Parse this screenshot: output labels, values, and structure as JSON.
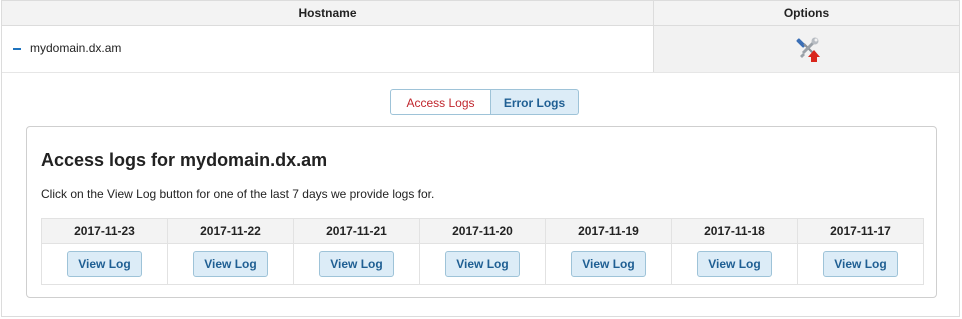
{
  "table": {
    "header_hostname": "Hostname",
    "header_options": "Options",
    "domain": "mydomain.dx.am",
    "options_icon": "tools-icon"
  },
  "tabs": [
    {
      "label": "Access Logs",
      "active": true
    },
    {
      "label": "Error Logs",
      "active": false
    }
  ],
  "panel": {
    "title": "Access logs for mydomain.dx.am",
    "description": "Click on the View Log button for one of the last 7 days we provide logs for.",
    "dates": [
      "2017-11-23",
      "2017-11-22",
      "2017-11-21",
      "2017-11-20",
      "2017-11-19",
      "2017-11-18",
      "2017-11-17"
    ],
    "button_label": "View Log"
  },
  "colors": {
    "active_tab_text": "#c0262d",
    "button_bg": "#dcecf7",
    "button_text": "#1f5f93"
  }
}
